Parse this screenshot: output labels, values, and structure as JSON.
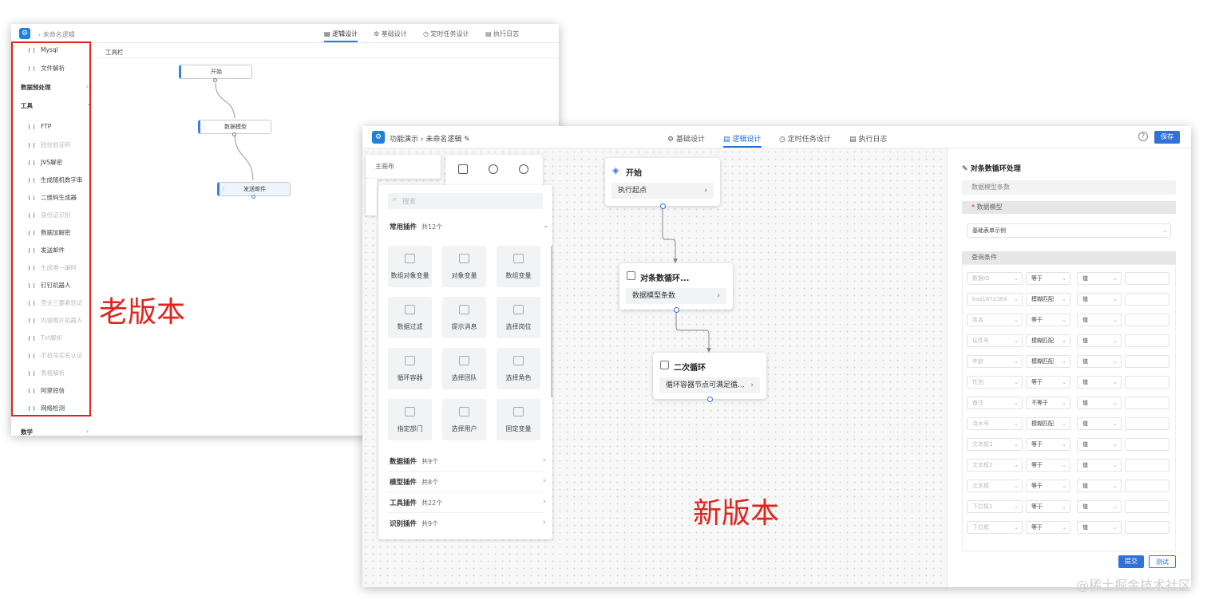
{
  "old_window": {
    "breadcrumb": "未命名逻辑",
    "tabs": [
      "逻辑设计",
      "基础设计",
      "定时任务设计",
      "执行日志"
    ],
    "sidebar_items": [
      {
        "label": "Mysql",
        "dim": false
      },
      {
        "label": "文件解析",
        "dim": false
      }
    ],
    "group_preprocess": "数据预处理",
    "group_tools": "工具",
    "tool_items": [
      {
        "label": "FTP",
        "dim": false
      },
      {
        "label": "短信验证码",
        "dim": true
      },
      {
        "label": "JVS解密",
        "dim": false
      },
      {
        "label": "生成随机数字串",
        "dim": false
      },
      {
        "label": "二维码生成器",
        "dim": false
      },
      {
        "label": "身份证识别",
        "dim": true
      },
      {
        "label": "数据加解密",
        "dim": false
      },
      {
        "label": "发送邮件",
        "dim": false
      },
      {
        "label": "生成唯一编码",
        "dim": true
      },
      {
        "label": "钉钉机器人",
        "dim": false
      },
      {
        "label": "营业三要素验证",
        "dim": true
      },
      {
        "label": "内容图片机器人",
        "dim": true
      },
      {
        "label": "Txt解析",
        "dim": true
      },
      {
        "label": "手机号实名认证",
        "dim": true
      },
      {
        "label": "表格解析",
        "dim": true
      },
      {
        "label": "阿里短信",
        "dim": false
      },
      {
        "label": "网络检测",
        "dim": false
      }
    ],
    "group_math": "数学",
    "toolbar": "工具栏",
    "nodes": [
      "开始",
      "数据模型",
      "发送邮件"
    ],
    "label": "老版本"
  },
  "new_window": {
    "breadcrumb_root": "功能演示",
    "breadcrumb_name": "未命名逻辑",
    "tabs": [
      "基础设计",
      "逻辑设计",
      "定时任务设计",
      "执行日志"
    ],
    "save": "保存",
    "panel_main": "主画布",
    "search_placeholder": "搜索",
    "common_plugins": {
      "title": "常用插件",
      "count": "共12个"
    },
    "plugins": [
      "数组对象变量",
      "对象变量",
      "数组变量",
      "数据过滤",
      "提示消息",
      "选择岗位",
      "循环容器",
      "选择团队",
      "选择角色",
      "指定部门",
      "选择用户",
      "固定变量"
    ],
    "categories": [
      {
        "title": "数据插件",
        "count": "共9个"
      },
      {
        "title": "模型插件",
        "count": "共8个"
      },
      {
        "title": "工具插件",
        "count": "共22个"
      },
      {
        "title": "识别插件",
        "count": "共9个"
      }
    ],
    "nodes": [
      {
        "title": "开始",
        "body": "执行起点"
      },
      {
        "title": "对条数循环...",
        "body": "数据模型条数"
      },
      {
        "title": "二次循环",
        "body": "循环容器节点可满足循..."
      }
    ],
    "label": "新版本",
    "right_panel": {
      "title": "对条数循环处理",
      "subtitle": "数据模型条数",
      "data_model_section": "数据模型",
      "data_model_value": "基础表单示例",
      "query_section": "查询条件",
      "query_rows": [
        {
          "field": "数据ID",
          "op": "等于",
          "val": "值"
        },
        {
          "field": "bsa1672384",
          "op": "模糊匹配",
          "val": "值"
        },
        {
          "field": "姓名",
          "op": "等于",
          "val": "值"
        },
        {
          "field": "证件号",
          "op": "模糊匹配",
          "val": "值"
        },
        {
          "field": "年龄",
          "op": "模糊匹配",
          "val": "值"
        },
        {
          "field": "性别",
          "op": "等于",
          "val": "值"
        },
        {
          "field": "备注",
          "op": "不等于",
          "val": "值"
        },
        {
          "field": "流水号",
          "op": "模糊匹配",
          "val": "值"
        },
        {
          "field": "文本框1",
          "op": "等于",
          "val": "值"
        },
        {
          "field": "文本框2",
          "op": "等于",
          "val": "值"
        },
        {
          "field": "文本框",
          "op": "等于",
          "val": "值"
        },
        {
          "field": "下拉框1",
          "op": "等于",
          "val": "值"
        },
        {
          "field": "下拉框",
          "op": "等于",
          "val": "值"
        }
      ],
      "submit": "提交",
      "test": "测试"
    }
  },
  "watermark": "@稀土掘金技术社区"
}
